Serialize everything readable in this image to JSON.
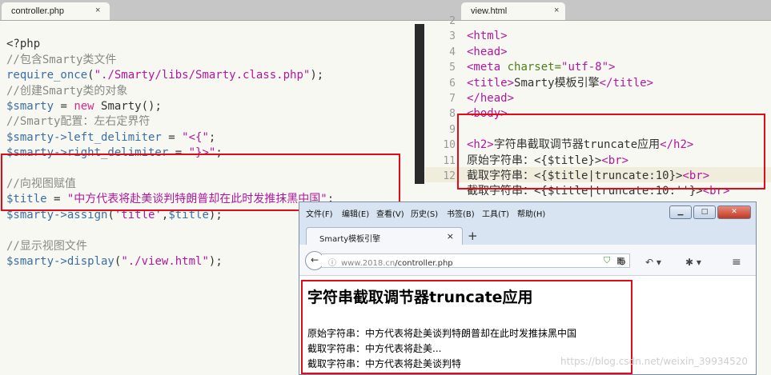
{
  "left_tab": {
    "title": "controller.php",
    "close": "×"
  },
  "right_tab": {
    "title": "view.html",
    "close": "×"
  },
  "php_code": {
    "l1": "<?php",
    "l2": "//包含Smarty类文件",
    "l3_fn": "require_once",
    "l3_open": "(",
    "l3_str": "\"./Smarty/libs/Smarty.class.php\"",
    "l3_close": ");",
    "l4": "//创建Smarty类的对象",
    "l5_var": "$smarty",
    "l5_eq": " = ",
    "l5_kw": "new",
    "l5_rest": " Smarty();",
    "l6": "//Smarty配置：左右定界符",
    "l7_var": "$smarty->",
    "l7_fn": "left_delimiter",
    "l7_eq": " = ",
    "l7_str": "\"<{\"",
    "l7_end": ";",
    "l8_var": "$smarty->",
    "l8_fn": "right_delimiter",
    "l8_eq": " = ",
    "l8_str": "\"}>\"",
    "l8_end": ";",
    "l9": "//向视图赋值",
    "l10_var": "$title",
    "l10_eq": " = ",
    "l10_str": "\"中方代表将赴美谈判特朗普却在此时发推抹黑中国\"",
    "l10_end": ";",
    "l11_var": "$smarty->",
    "l11_fn": "assign",
    "l11_open": "(",
    "l11_str": "'title'",
    "l11_comma": ",",
    "l11_var2": "$title",
    "l11_close": ");",
    "l12": "//显示视图文件",
    "l13_var": "$smarty->",
    "l13_fn": "display",
    "l13_open": "(",
    "l13_str": "\"./view.html\"",
    "l13_close": ");"
  },
  "gutter": [
    "2",
    "3",
    "4",
    "5",
    "6",
    "7",
    "8",
    "9",
    "10",
    "11",
    "12"
  ],
  "html_code": {
    "l2": "<html>",
    "l3": "<head>",
    "l4_tag": "<meta",
    "l4_attr": " charset=",
    "l4_val": "\"utf-8\"",
    "l4_end": ">",
    "l5_open": "<title>",
    "l5_text": "Smarty模板引擎",
    "l5_close": "</title>",
    "l6": "</head>",
    "l7": "<body>",
    "l9_open": "<h2>",
    "l9_text": "字符串截取调节器truncate应用",
    "l9_close": "</h2>",
    "l10_text": "原始字符串：",
    "l10_tpl": "<{$title}>",
    "l10_br": "<br>",
    "l11_text": "截取字符串：",
    "l11_tpl": "<{$title|truncate:10}>",
    "l11_br": "<br>",
    "l12_text": "截取字符串：",
    "l12_tpl": "<{$title|truncate:10:''}>",
    "l12_br": "<br>"
  },
  "browser": {
    "menu": [
      "文件(F)",
      "编辑(E)",
      "查看(V)",
      "历史(S)",
      "书签(B)",
      "工具(T)",
      "帮助(H)"
    ],
    "tab_title": "Smarty模板引擎",
    "tab_close": "×",
    "new_tab": "+",
    "url_info": "ⓘ",
    "url_host": "www.2018.cn",
    "url_path": "/controller.php",
    "page_heading": "字符串截取调节器truncate应用",
    "line1": "原始字符串：中方代表将赴美谈判特朗普却在此时发推抹黑中国",
    "line2": "截取字符串：中方代表将赴美...",
    "line3": "截取字符串：中方代表将赴美谈判特",
    "watermark": "https://blog.csdn.net/weixin_39934520"
  },
  "colors": {
    "highlight_box": "#e30b17",
    "editor_bg": "#f8f8f2",
    "comment": "#888a85",
    "string": "#b0179f",
    "variable": "#3a6ea5"
  }
}
